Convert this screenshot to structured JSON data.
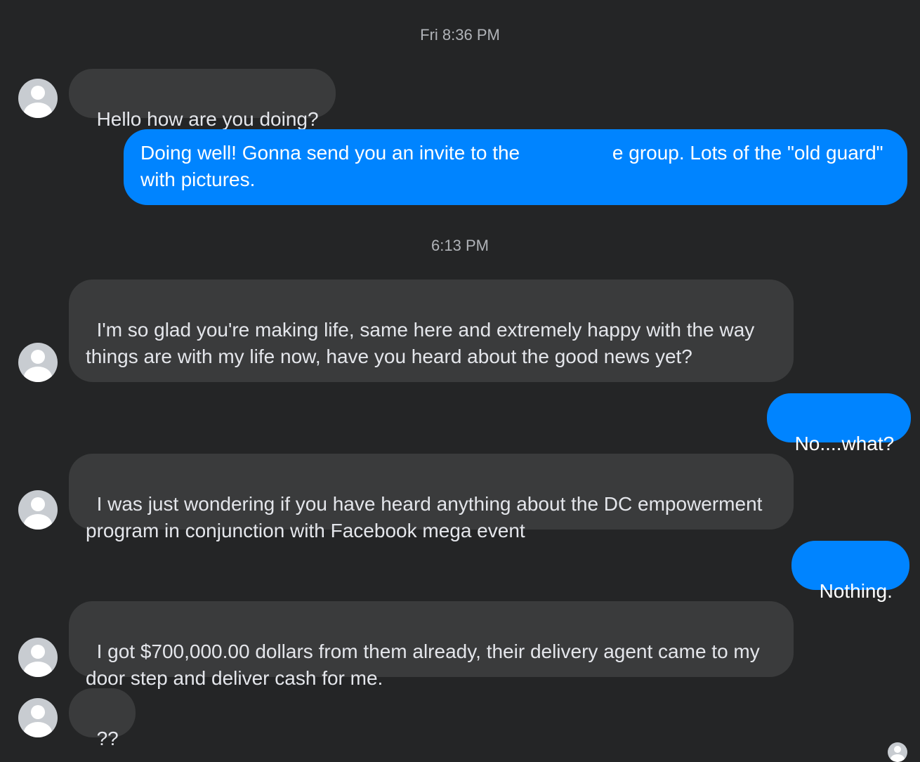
{
  "timestamps": [
    "Fri 8:36 PM",
    "6:13 PM"
  ],
  "messages": [
    {
      "sender": "them",
      "text": "Hello how are you doing?"
    },
    {
      "sender": "me",
      "text_before": "Doing well! Gonna send you an invite to the ",
      "text_after": "e group. Lots of the \"old guard\" with pictures."
    },
    {
      "sender": "them",
      "text": "I'm so glad you're making life, same here and extremely happy with the way things are with my life now, have you heard about the good news yet?"
    },
    {
      "sender": "me",
      "text": "No....what?"
    },
    {
      "sender": "them",
      "text": "I was just wondering if you have heard anything about the DC empowerment program in conjunction with Facebook mega event"
    },
    {
      "sender": "me",
      "text": "Nothing."
    },
    {
      "sender": "them",
      "text": "I got $700,000.00 dollars from them already, their delivery agent came to my door step and deliver cash for me."
    },
    {
      "sender": "them",
      "text": "??"
    }
  ],
  "icons": {
    "avatar": "default-user-avatar-icon",
    "read_receipt": "read-receipt-avatar-icon"
  },
  "colors": {
    "background": "#242526",
    "incoming_bubble": "#3a3b3c",
    "outgoing_bubble": "#0084ff",
    "timestamp_text": "#b0b3b8"
  }
}
